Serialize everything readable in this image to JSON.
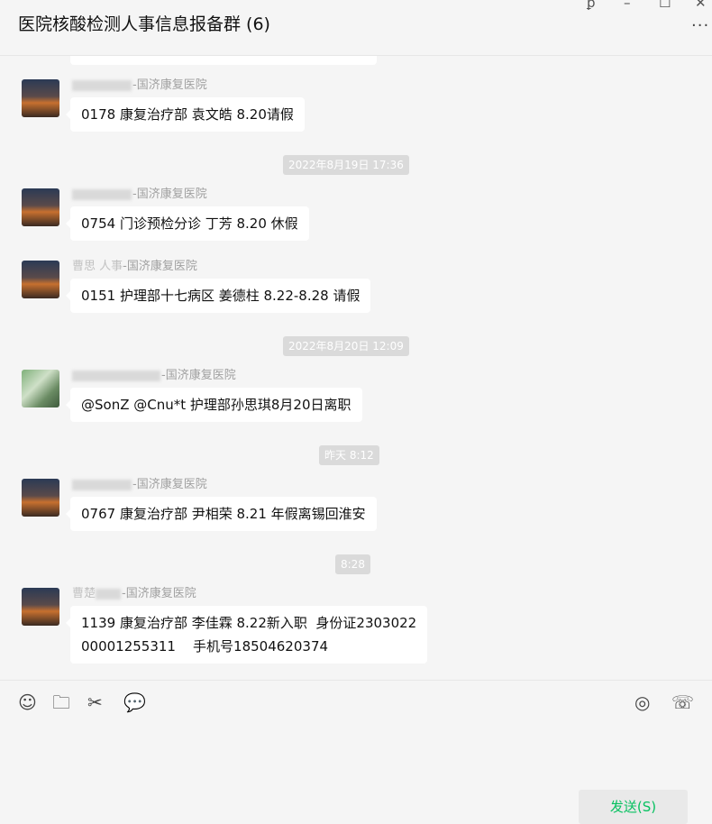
{
  "window": {
    "title": "医院核酸检测人事信息报备群 (6)",
    "pin_icon": "ꝑ",
    "min_icon": "–",
    "max_icon": "☐",
    "close_icon": "✕",
    "more_icon": "···"
  },
  "messages": [
    {
      "sender": "-国济康复医院",
      "text": "0178  康复治疗部 袁文皓  8.20请假"
    },
    {
      "timestamp": "2022年8月19日 17:36"
    },
    {
      "sender": "-国济康复医院",
      "text": "0754 门诊预检分诊 丁芳  8.20 休假"
    },
    {
      "sender_prefix": "曹思 人事",
      "sender": "-国济康复医院",
      "text": "0151 护理部十七病区 姜德柱 8.22-8.28 请假"
    },
    {
      "timestamp": "2022年8月20日 12:09"
    },
    {
      "sender": "-国济康复医院",
      "text": "@SonZ @Cnu*t 护理部孙思琪8月20日离职"
    },
    {
      "timestamp": "昨天 8:12"
    },
    {
      "sender": "-国济康复医院",
      "text": "0767  康复治疗部 尹相荣 8.21 年假离锡回淮安"
    },
    {
      "timestamp": "8:28"
    },
    {
      "sender_prefix": "曹楚",
      "sender": "-国济康复医院",
      "text": "1139 康复治疗部 李佳霖 8.22新入职  身份证2303022\n00001255311    手机号18504620374"
    }
  ],
  "toolbar": {
    "emoji_icon": "☺",
    "folder_icon": "🗀",
    "scissor_icon": "✂",
    "chat_icon": "💬",
    "live_icon": "◎",
    "call_icon": "☏"
  },
  "send_button": {
    "label": "发送(S)"
  }
}
